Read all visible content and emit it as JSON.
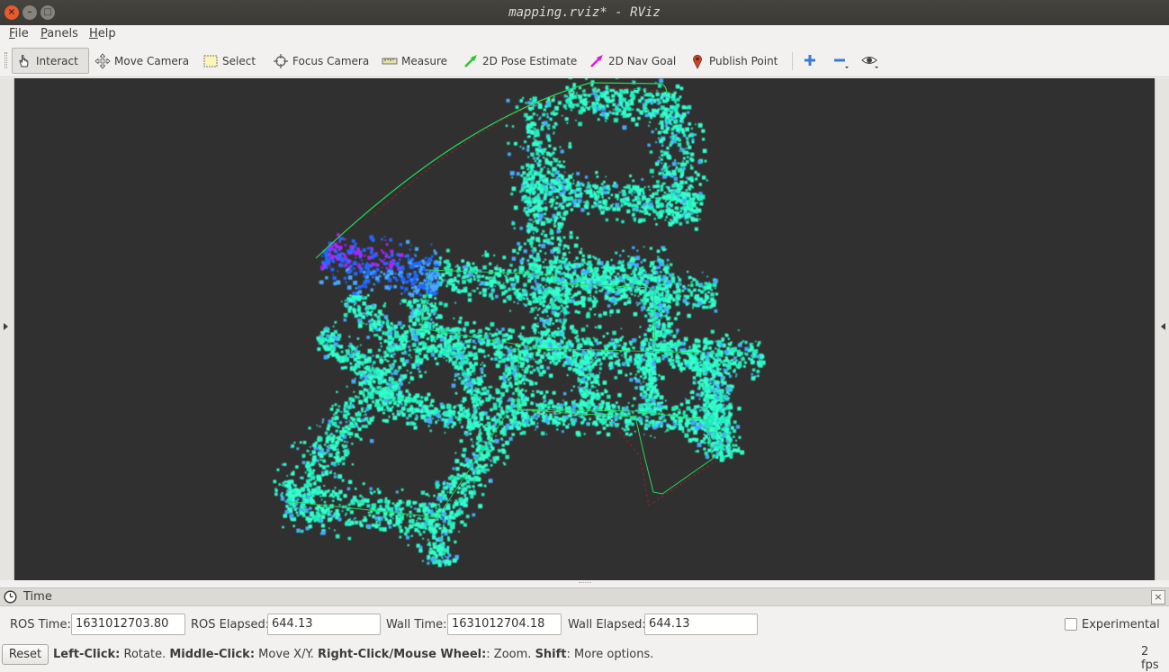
{
  "window": {
    "title": "mapping.rviz* - RViz",
    "close_glyph": "×",
    "min_glyph": "–",
    "max_glyph": "□"
  },
  "menu": {
    "file": {
      "mnemonic": "F",
      "rest": "ile"
    },
    "panels": {
      "mnemonic": "P",
      "rest": "anels"
    },
    "help": {
      "mnemonic": "H",
      "rest": "elp"
    }
  },
  "toolbar": {
    "tools": [
      {
        "label": "Interact",
        "icon": "hand-pointer-icon",
        "active": true
      },
      {
        "label": "Move Camera",
        "icon": "move-camera-icon",
        "active": false
      },
      {
        "label": "Select",
        "icon": "select-box-icon",
        "active": false
      },
      {
        "label": "Focus Camera",
        "icon": "focus-crosshair-icon",
        "active": false
      },
      {
        "label": "Measure",
        "icon": "ruler-icon",
        "active": false
      },
      {
        "label": "2D Pose Estimate",
        "icon": "green-arrow-icon",
        "active": false
      },
      {
        "label": "2D Nav Goal",
        "icon": "magenta-arrow-icon",
        "active": false
      },
      {
        "label": "Publish Point",
        "icon": "map-pin-icon",
        "active": false
      }
    ],
    "extra_buttons": [
      "add-tool-icon",
      "remove-tool-icon",
      "view-eye-icon"
    ]
  },
  "viewport": {
    "background": "#303030",
    "path_color": "#22dd55",
    "cloud_colors": [
      "#33ffcc",
      "#22eebb",
      "#44aaff",
      "#2266ff",
      "#aa22ff"
    ]
  },
  "time_panel": {
    "title": "Time",
    "close_glyph": "×",
    "ros_time_label": "ROS Time:",
    "ros_time": "1631012703.80",
    "ros_elapsed_label": "ROS Elapsed:",
    "ros_elapsed": "644.13",
    "wall_time_label": "Wall Time:",
    "wall_time": "1631012704.18",
    "wall_elapsed_label": "Wall Elapsed:",
    "wall_elapsed": "644.13",
    "experimental_label": "Experimental",
    "experimental_checked": false
  },
  "status": {
    "reset_label": "Reset",
    "left_click": "Left-Click:",
    "left_click_action": " Rotate. ",
    "middle_click": "Middle-Click:",
    "middle_click_action": " Move X/Y. ",
    "right_click": "Right-Click/Mouse Wheel:",
    "right_click_action": ": Zoom. ",
    "shift": "Shift",
    "shift_action": ": More options.",
    "fps": "2 fps"
  }
}
